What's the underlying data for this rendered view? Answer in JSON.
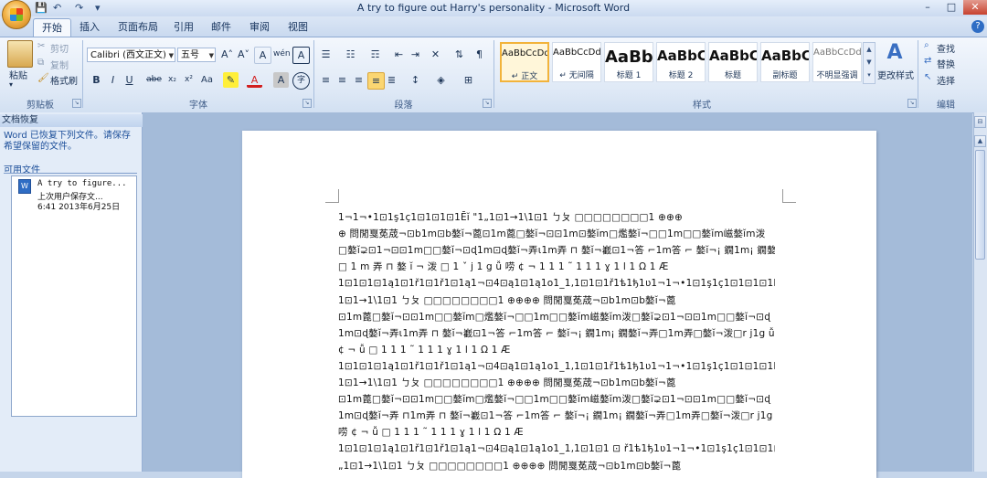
{
  "window": {
    "title": "A try to figure out Harry's personality - Microsoft Word",
    "controls": [
      "–",
      "□",
      "✕"
    ]
  },
  "quick_access": [
    "💾",
    "↶",
    "↷",
    "▾"
  ],
  "tabs": [
    "开始",
    "插入",
    "页面布局",
    "引用",
    "邮件",
    "审阅",
    "视图"
  ],
  "active_tab": "开始",
  "clipboard": {
    "paste": "粘贴",
    "cut": "剪切",
    "copy": "复制",
    "format_painter": "格式刷",
    "group": "剪贴板"
  },
  "font": {
    "name": "Calibri (西文正文)",
    "size": "五号",
    "group": "字体",
    "bold": "B",
    "italic": "I",
    "underline": "U",
    "strike": "abe",
    "subscript": "x₂",
    "superscript": "x²",
    "change_case": "Aa",
    "grow": "A˄",
    "shrink": "A˅",
    "clear": "A",
    "phonetic": "wén",
    "border_char": "A",
    "shading_char": "A",
    "enclose": "字"
  },
  "paragraph": {
    "group": "段落"
  },
  "styles": {
    "group": "样式",
    "items": [
      {
        "sample": "AaBbCcDd",
        "name": "↵ 正文",
        "selected": true,
        "size": "10px",
        "weight": "normal"
      },
      {
        "sample": "AaBbCcDd",
        "name": "↵ 无间隔",
        "selected": false,
        "size": "10px",
        "weight": "normal"
      },
      {
        "sample": "AaBb",
        "name": "标题 1",
        "selected": false,
        "size": "18px",
        "weight": "bold"
      },
      {
        "sample": "AaBbC",
        "name": "标题 2",
        "selected": false,
        "size": "15px",
        "weight": "bold"
      },
      {
        "sample": "AaBbC",
        "name": "标题",
        "selected": false,
        "size": "15px",
        "weight": "bold"
      },
      {
        "sample": "AaBbC",
        "name": "副标题",
        "selected": false,
        "size": "15px",
        "weight": "bold"
      },
      {
        "sample": "AaBbCcDd",
        "name": "不明显强调",
        "selected": false,
        "size": "10px",
        "weight": "normal"
      }
    ],
    "change_styles": "更改样式"
  },
  "editing": {
    "group": "编辑",
    "find": "查找",
    "replace": "替换",
    "select": "选择"
  },
  "recovery_pane": {
    "title": "文档恢复",
    "message": "Word 已恢复下列文件。请保存希望保留的文件。",
    "available_label": "可用文件",
    "file_line1": "A try to figure...",
    "file_line2": "上次用户保存文...",
    "file_line3": "6:41 2013年6月25日"
  },
  "document": {
    "lines": [
      "1¬1¬•1⊡1ş1ç1⊡1⊡1⊡1Ēĭ \"1„1⊡1→1\\1⊡1        ㄅㄆ     □□□□□□□□1 ⊕⊕⊕",
      "⊕ 問閒戛莬荿¬⊡b1m⊡b嫯ĭ¬蓖⊡1m蓖□嫯ĭ¬⊡⊡1m⊡嫯ĭm□爁嫯ĭ¬□□1m□□嫯ĭm嵫嫯ĭm泼",
      "□嫯ĭ⊋⊡1¬⊡⊡1m□□嫯ĭ¬⊡ɖ1m⊡ɖ嫯ĭ¬弄ɩ1m弄 ⊓ 嫯ĭ¬嶻⊡1¬答 ⌐1m答 ⌐ 嫯ĭ¬¡ 鐗1m¡ 鐗嫯ĭ¬弄",
      "□ 1 m 弄 ⊓  嫯 ĭ ¬ 泼  □ 1 ˇ j 1 g   ǚ  唠   ¢ ¬    1 1 1 ˜ 1    1      1 ɣ 1 l 1 Ω 1 Æ",
      "1⊡1⊡1⊡1ą1⊡1ř1⊡1ř1⊡1ą1¬⊡4⊡ą1⊡1ą1o1_1‚1⊡1⊡1ř1ѣ1ђ1ʋ1¬1¬•1⊡1ş1ç1⊡1⊡1⊡1Ēĭ \"1„",
      "1⊡1→1\\1⊡1        ㄅㄆ     □□□□□□□□1 ⊕⊕⊕⊕ 問閒戛莬荿¬⊡b1m⊡b嫯ĭ¬蓖",
      "⊡1m蓖□嫯ĭ¬⊡⊡1m□□嫯ĭm□爁嫯ĭ¬□□1m□□嫯ĭm嵫嫯ĭm泼□嫯ĭ⊋⊡1¬⊡⊡1m□□嫯ĭ¬⊡ɖ",
      "1m⊡ɖ嫯ĭ¬弄ɩ1m弄 ⊓ 嫯ĭ¬嶻⊡1¬答 ⌐1m答 ⌐ 嫯ĭ¬¡ 鐗1m¡ 鐗嫯ĭ¬弄□1m弄□嫯ĭ¬泼□r j1g  ǚ唠",
      "¢   ¬          ǚ    □     1    1    1    ˜    1          1          1   ɣ   1   l   1   Ω   1   Æ",
      "1⊡1⊡1⊡1ą1⊡1ř1⊡1ř1⊡1ą1¬⊡4⊡ą1⊡1ą1o1_1‚1⊡1⊡1ř1ѣ1ђ1ʋ1¬1¬•1⊡1ş1ç1⊡1⊡1⊡1Ēĭ \"1„",
      "1⊡1→1\\1⊡1        ㄅㄆ     □□□□□□□□1 ⊕⊕⊕⊕ 問閒戛莬荿¬⊡b1m⊡b嫯ĭ¬蓖",
      "⊡1m蓖□嫯ĭ¬⊡⊡1m□□嫯ĭm□爁嫯ĭ¬□□1m□□嫯ĭm嵫嫯ĭm泼□嫯ĭ⊋⊡1¬⊡⊡1m□□嫯ĭ¬⊡ɖ",
      "1m⊡ɖ嫯ĭ¬弄 ⊓1m弄 ⊓ 嫯ĭ¬嶻⊡1¬答 ⌐1m答 ⌐ 嫯ĭ¬¡ 鐗1m¡ 鐗嫯ĭ¬弄□1m弄□嫯ĭ¬泼□r j1g    ǚ",
      "唠    ¢   ¬          ǚ    □     1    1    1    ˜    1          1          1   ɣ   1   l   1   Ω   1   Æ",
      "1⊡1⊡1⊡1ą1⊡1ř1⊡1ř1⊡1ą1¬⊡4⊡ą1⊡1ą1o1_1‚1⊡1⊡1 ⊡ ř1ѣ1ђ1ʋ1¬1¬•1⊡1ş1ç1⊡1⊡1⊡1Ēĭ \"1",
      "„1⊡1→1\\1⊡1        ㄅㄆ       □□□□□□□□1 ⊕⊕⊕⊕ 問閒戛莬荿¬⊡b1m⊡b嫯ĭ¬蓖"
    ]
  }
}
